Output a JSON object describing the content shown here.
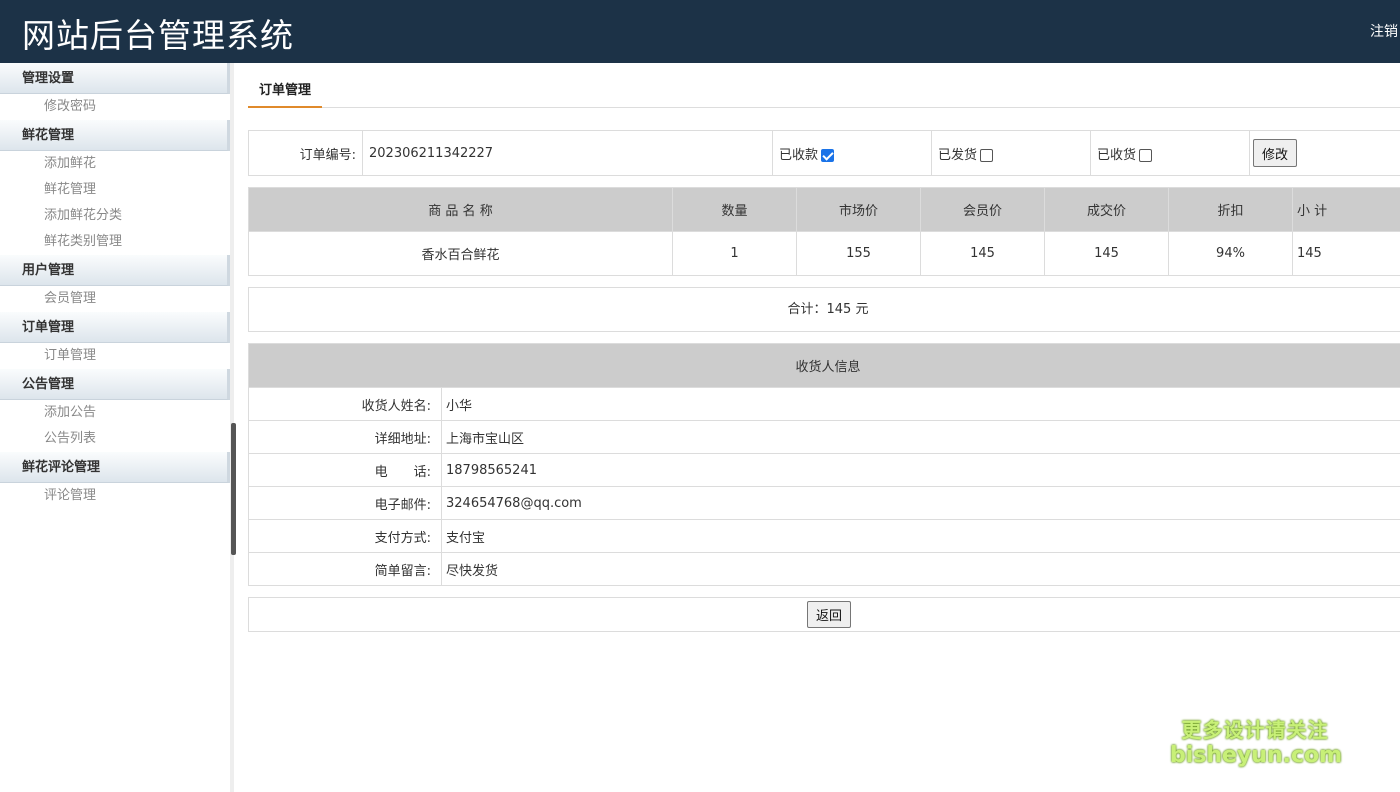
{
  "header": {
    "title": "网站后台管理系统",
    "logout": "注销"
  },
  "sidebar": {
    "groups": [
      {
        "label": "管理设置",
        "items": [
          "修改密码"
        ]
      },
      {
        "label": "鲜花管理",
        "items": [
          "添加鲜花",
          "鲜花管理",
          "添加鲜花分类",
          "鲜花类别管理"
        ]
      },
      {
        "label": "用户管理",
        "items": [
          "会员管理"
        ]
      },
      {
        "label": "订单管理",
        "items": [
          "订单管理"
        ]
      },
      {
        "label": "公告管理",
        "items": [
          "添加公告",
          "公告列表"
        ]
      },
      {
        "label": "鲜花评论管理",
        "items": [
          "评论管理"
        ]
      }
    ]
  },
  "main": {
    "tab": "订单管理",
    "order": {
      "number_label": "订单编号:",
      "number": "202306211342227",
      "paid_label": "已收款",
      "paid": true,
      "shipped_label": "已发货",
      "shipped": false,
      "received_label": "已收货",
      "received": false,
      "modify_button": "修改"
    },
    "items_table": {
      "headers": [
        "商 品 名 称",
        "数量",
        "市场价",
        "会员价",
        "成交价",
        "折扣",
        "小 计"
      ],
      "rows": [
        [
          "香水百合鲜花",
          "1",
          "155",
          "145",
          "145",
          "94%",
          "145"
        ]
      ]
    },
    "total": "合计：145 元",
    "receiver": {
      "title": "收货人信息",
      "rows": [
        {
          "label": "收货人姓名:",
          "value": "小华"
        },
        {
          "label": "详细地址:",
          "value": "上海市宝山区"
        },
        {
          "label": "电　　话:",
          "value": "18798565241"
        },
        {
          "label": "电子邮件:",
          "value": "324654768@qq.com"
        },
        {
          "label": "支付方式:",
          "value": "支付宝"
        },
        {
          "label": "简单留言:",
          "value": "尽快发货"
        }
      ]
    },
    "back_button": "返回"
  },
  "watermark": {
    "line1": "更多设计请关注",
    "line2": "bisheyun.com"
  }
}
